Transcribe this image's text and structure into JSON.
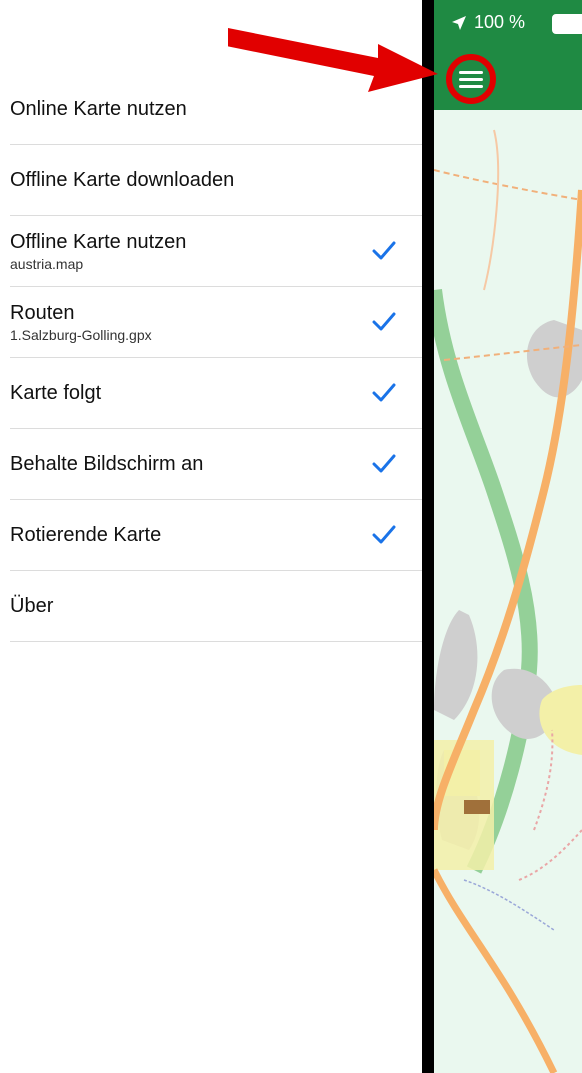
{
  "menu": {
    "items": [
      {
        "title": "Online Karte nutzen",
        "subtitle": "",
        "checked": false
      },
      {
        "title": "Offline Karte downloaden",
        "subtitle": "",
        "checked": false
      },
      {
        "title": "Offline Karte nutzen",
        "subtitle": "austria.map",
        "checked": true
      },
      {
        "title": "Routen",
        "subtitle": "1.Salzburg-Golling.gpx",
        "checked": true
      },
      {
        "title": "Karte folgt",
        "subtitle": "",
        "checked": true
      },
      {
        "title": "Behalte Bildschirm an",
        "subtitle": "",
        "checked": true
      },
      {
        "title": "Rotierende Karte",
        "subtitle": "",
        "checked": true
      },
      {
        "title": "Über",
        "subtitle": "",
        "checked": false
      }
    ]
  },
  "status": {
    "battery_text": "100 %"
  },
  "colors": {
    "appbar": "#1f8a43",
    "highlight": "#e10000",
    "check": "#1a73e8"
  },
  "icons": {
    "menu": "hamburger-icon",
    "check": "checkmark-icon",
    "location": "location-arrow-icon"
  }
}
